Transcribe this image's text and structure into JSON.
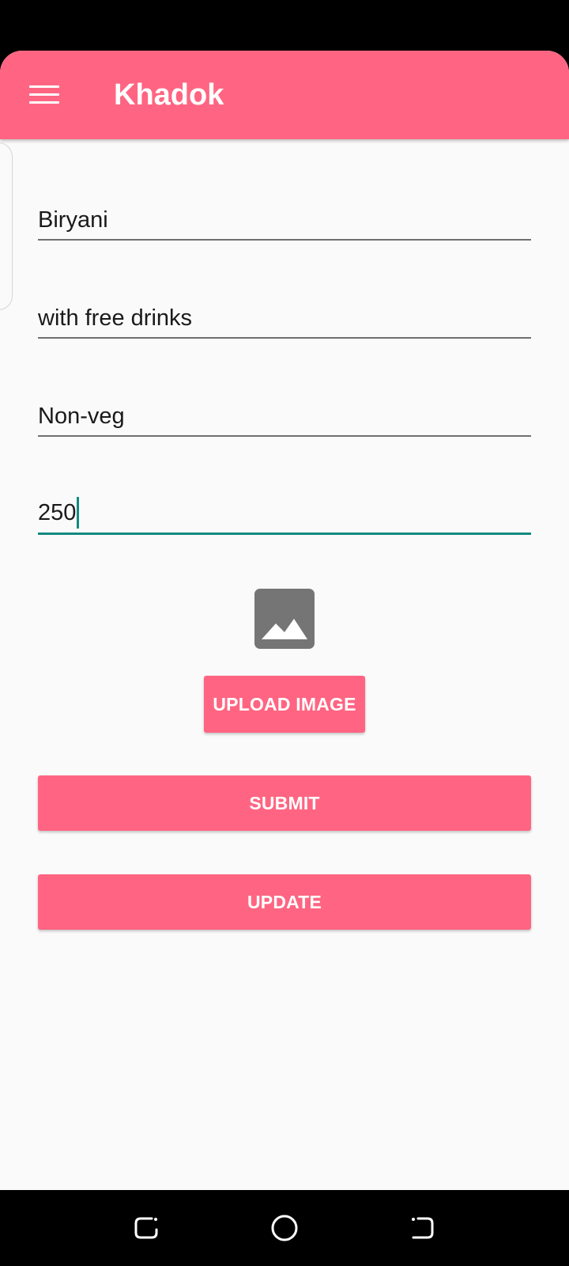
{
  "app_bar": {
    "title": "Khadok",
    "menu_icon": "hamburger-menu-icon",
    "color": "#ff6582"
  },
  "form": {
    "fields": [
      {
        "value": "Biryani",
        "focused": false
      },
      {
        "value": "with free drinks",
        "focused": false
      },
      {
        "value": "Non-veg",
        "focused": false
      },
      {
        "value": "250",
        "focused": true
      }
    ],
    "image_placeholder_icon": "image-icon",
    "upload_label": "UPLOAD IMAGE",
    "submit_label": "SUBMIT",
    "update_label": "UPDATE"
  },
  "colors": {
    "accent": "#ff6582",
    "focus": "#138a7f",
    "background": "#fafafa"
  },
  "nav_bar": {
    "icons": [
      "recents-icon",
      "home-icon",
      "back-icon"
    ]
  }
}
